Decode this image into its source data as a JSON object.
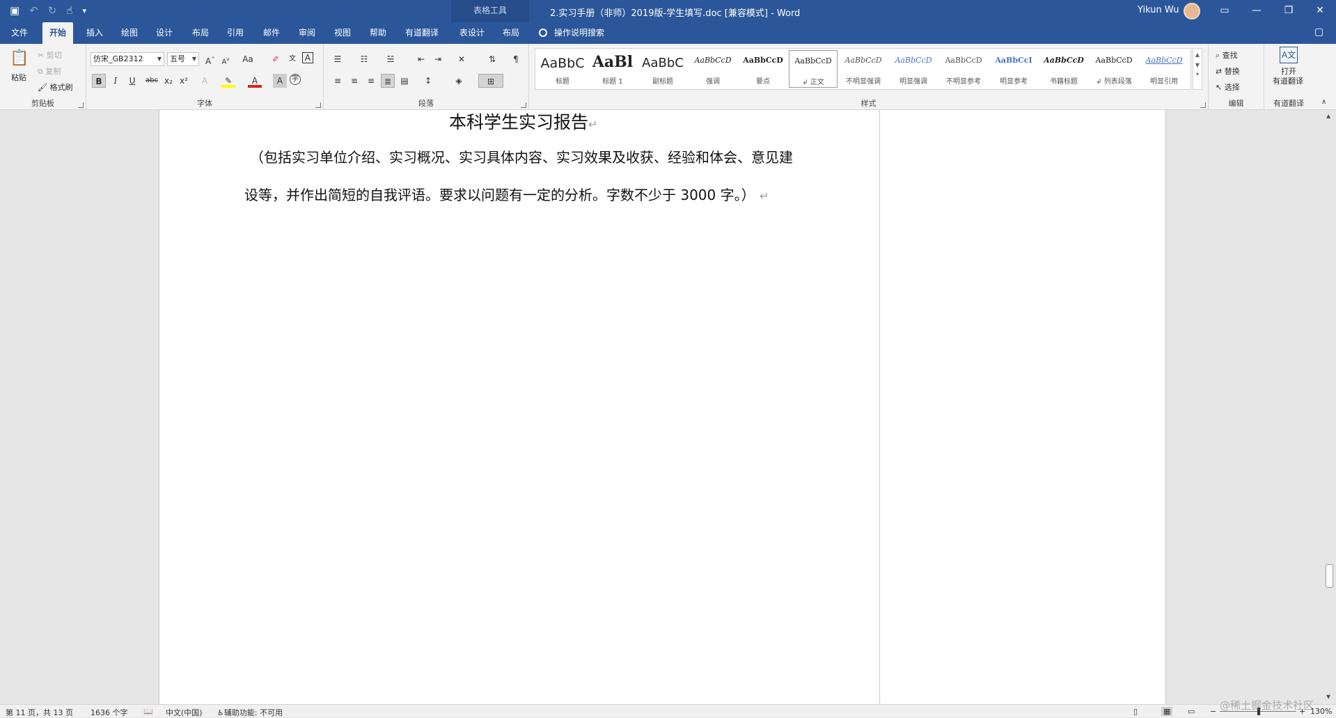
{
  "titlebar": {
    "context_header": "表格工具",
    "doc_title": "2.实习手册（非师）2019版-学生填写.doc [兼容模式]  -  Word",
    "user": "Yikun Wu",
    "bg_color": "#2b579a"
  },
  "tabs": [
    {
      "label": "文件"
    },
    {
      "label": "开始"
    },
    {
      "label": "插入"
    },
    {
      "label": "绘图"
    },
    {
      "label": "设计"
    },
    {
      "label": "布局"
    },
    {
      "label": "引用"
    },
    {
      "label": "邮件"
    },
    {
      "label": "审阅"
    },
    {
      "label": "视图"
    },
    {
      "label": "帮助"
    },
    {
      "label": "有道翻译"
    },
    {
      "label": "表设计"
    },
    {
      "label": "布局"
    }
  ],
  "tell_me": "操作说明搜索",
  "clipboard": {
    "paste": "粘贴",
    "cut": "剪切",
    "copy": "复制",
    "format_painter": "格式刷",
    "label": "剪贴板"
  },
  "font": {
    "name": "仿宋_GB2312",
    "size": "五号",
    "case_btn": "Aa",
    "label": "字体",
    "bold": "B",
    "italic": "I",
    "underline": "U",
    "strike": "abc",
    "sub": "x₂",
    "sup": "x²"
  },
  "paragraph": {
    "label": "段落"
  },
  "styles": {
    "label": "样式",
    "items": [
      {
        "preview": "AaBbC",
        "name": "标题"
      },
      {
        "preview": "AaBl",
        "name": "标题 1"
      },
      {
        "preview": "AaBbC",
        "name": "副标题"
      },
      {
        "preview": "AaBbCcD",
        "name": "强调"
      },
      {
        "preview": "AaBbCcD",
        "name": "要点"
      },
      {
        "preview": "AaBbCcD",
        "name": "↲ 正文"
      },
      {
        "preview": "AaBbCcD",
        "name": "不明显强调"
      },
      {
        "preview": "AaBbCcD",
        "name": "明显强调"
      },
      {
        "preview": "AaBbCcD",
        "name": "不明显参考"
      },
      {
        "preview": "AaBbCcI",
        "name": "明显参考"
      },
      {
        "preview": "AaBbCcD",
        "name": "书籍标题"
      },
      {
        "preview": "AaBbCcD",
        "name": "↲ 列表段落"
      },
      {
        "preview": "AaBbCcD",
        "name": "明显引用"
      }
    ]
  },
  "editing": {
    "find": "查找",
    "replace": "替换",
    "select": "选择",
    "label": "编辑"
  },
  "youdao": {
    "line1": "打开",
    "line2": "有道翻译",
    "label": "有道翻译"
  },
  "document": {
    "title": "本科学生实习报告",
    "line1": "（包括实习单位介绍、实习概况、实习具体内容、实习效果及收获、经验和体会、意见建",
    "line2": "设等，并作出简短的自我评语。要求以问题有一定的分析。字数不少于 3000 字。）",
    "para_mark": "↵"
  },
  "statusbar": {
    "page": "第 11 页，共 13 页",
    "words": "1636 个字",
    "language": "中文(中国)",
    "accessibility": "辅助功能: 不可用",
    "zoom": "130%"
  },
  "watermark": "@稀土掘金技术社区"
}
